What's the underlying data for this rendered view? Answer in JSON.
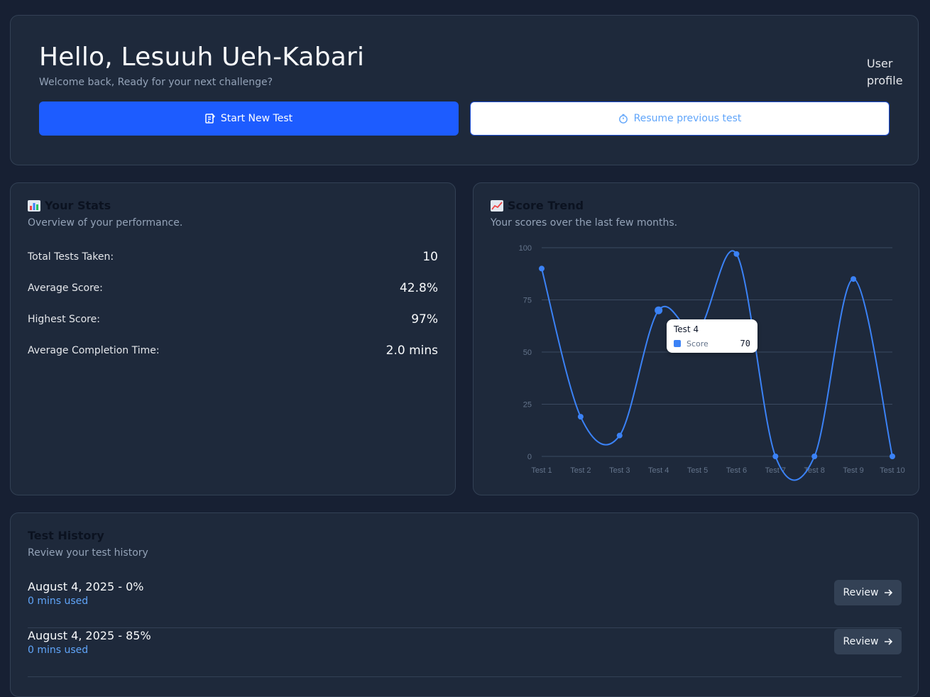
{
  "hero": {
    "greeting": "Hello, Lesuuh Ueh-Kabari",
    "subtitle": "Welcome back, Ready for your next challenge?",
    "profile_label": "User profile",
    "start_label": "Start New Test",
    "resume_label": "Resume previous test"
  },
  "stats": {
    "title": "Your Stats",
    "description": "Overview of your performance.",
    "rows": [
      {
        "label": "Total Tests Taken:",
        "value": "10"
      },
      {
        "label": "Average Score:",
        "value": "42.8%"
      },
      {
        "label": "Highest Score:",
        "value": "97%"
      },
      {
        "label": "Average Completion Time:",
        "value": "2.0 mins"
      }
    ]
  },
  "trend": {
    "title": "Score Trend",
    "description": "Your scores over the last few months.",
    "tooltip": {
      "title": "Test 4",
      "series": "Score",
      "value": "70"
    }
  },
  "chart_data": {
    "type": "line",
    "categories": [
      "Test 1",
      "Test 2",
      "Test 3",
      "Test 4",
      "Test 5",
      "Test 6",
      "Test 7",
      "Test 8",
      "Test 9",
      "Test 10"
    ],
    "series": [
      {
        "name": "Score",
        "values": [
          90,
          19,
          10,
          70,
          60,
          97,
          0,
          0,
          85,
          0
        ]
      }
    ],
    "ylim": [
      0,
      100
    ],
    "yticks": [
      0,
      25,
      50,
      75,
      100
    ],
    "grid": true,
    "color": "#3b82f6"
  },
  "history": {
    "title": "Test History",
    "description": "Review your test history",
    "review_label": "Review",
    "items": [
      {
        "title": "August 4, 2025 - 0%",
        "sub": "0 mins used"
      },
      {
        "title": "August 4, 2025 - 85%",
        "sub": "0 mins used"
      }
    ]
  },
  "colors": {
    "accent": "#1d5cff",
    "line": "#3b82f6",
    "card": "#1e293b",
    "bg": "#172033"
  }
}
